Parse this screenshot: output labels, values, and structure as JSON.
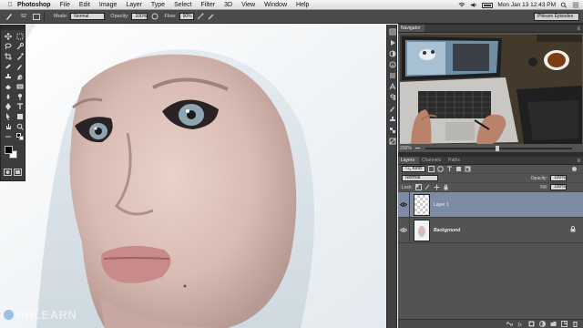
{
  "menubar": {
    "app_name": "Photoshop",
    "items": [
      "File",
      "Edit",
      "Image",
      "Layer",
      "Type",
      "Select",
      "Filter",
      "3D",
      "View",
      "Window",
      "Help"
    ],
    "clock": "Mon Jan 13  12:43 PM"
  },
  "options_bar": {
    "brush_size": "52",
    "mode_label": "Mode:",
    "mode_value": "Normal",
    "opacity_label": "Opacity:",
    "opacity_value": "100%",
    "flow_label": "Flow:",
    "flow_value": "90%",
    "workspace": "Phlearn Episodes"
  },
  "navigator": {
    "tab": "Navigator",
    "zoom": "200%"
  },
  "layers_panel": {
    "tabs": [
      "Layers",
      "Channels",
      "Paths"
    ],
    "filter_label": "Kind",
    "blend_mode": "Normal",
    "opacity_label": "Opacity:",
    "opacity_value": "100%",
    "lock_label": "Lock:",
    "fill_label": "Fill:",
    "fill_value": "100%",
    "layers": [
      {
        "name": "Layer 1",
        "active": true
      },
      {
        "name": "Background",
        "active": false
      }
    ]
  },
  "watermark": "PHLEARN"
}
